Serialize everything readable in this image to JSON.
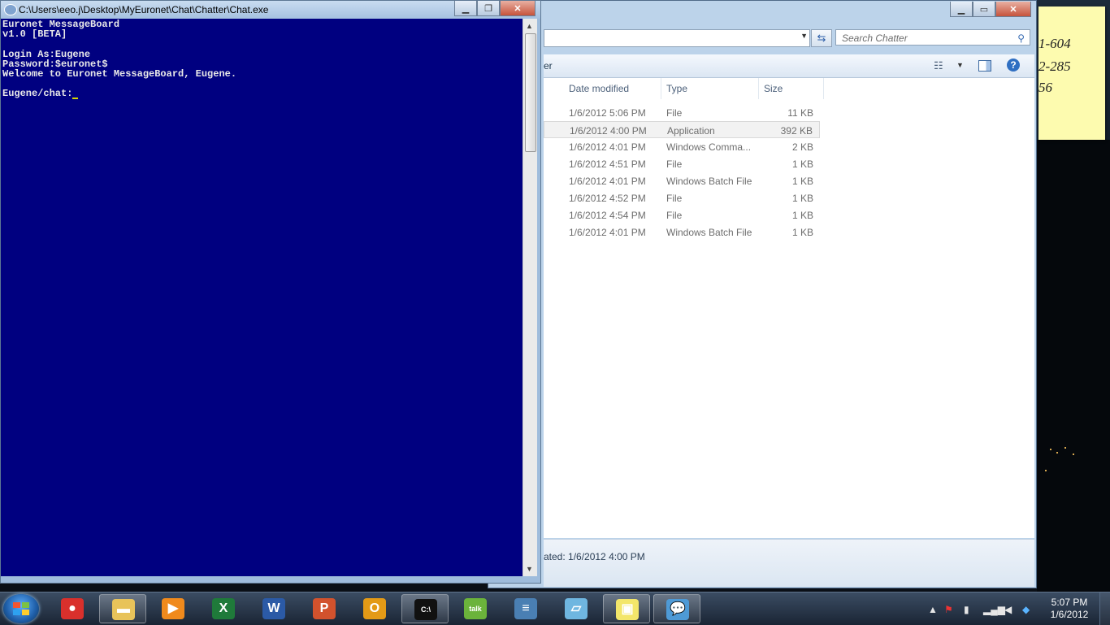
{
  "sticky_note": {
    "lines": [
      "1-604",
      "2-285",
      "56"
    ]
  },
  "explorer": {
    "search_placeholder": "Search Chatter",
    "cmdbar_text": "er",
    "columns": [
      "Date modified",
      "Type",
      "Size"
    ],
    "files": [
      {
        "date": "1/6/2012 5:06 PM",
        "type": "File",
        "size": "11 KB"
      },
      {
        "date": "1/6/2012 4:00 PM",
        "type": "Application",
        "size": "392 KB"
      },
      {
        "date": "1/6/2012 4:01 PM",
        "type": "Windows Comma...",
        "size": "2 KB"
      },
      {
        "date": "1/6/2012 4:51 PM",
        "type": "File",
        "size": "1 KB"
      },
      {
        "date": "1/6/2012 4:01 PM",
        "type": "Windows Batch File",
        "size": "1 KB"
      },
      {
        "date": "1/6/2012 4:52 PM",
        "type": "File",
        "size": "1 KB"
      },
      {
        "date": "1/6/2012 4:54 PM",
        "type": "File",
        "size": "1 KB"
      },
      {
        "date": "1/6/2012 4:01 PM",
        "type": "Windows Batch File",
        "size": "1 KB"
      }
    ],
    "details_text": "ated: 1/6/2012 4:00 PM"
  },
  "console": {
    "title": "C:\\Users\\eeo.j\\Desktop\\MyEuronet\\Chat\\Chatter\\Chat.exe",
    "lines": [
      "Euronet MessageBoard",
      "v1.0 [BETA]",
      "",
      "Login As:Eugene",
      "Password:$euronet$",
      "Welcome to Euronet MessageBoard, Eugene.",
      "",
      "Eugene/chat:"
    ]
  },
  "taskbar": {
    "items": [
      {
        "name": "chrome",
        "icon": "chrome-icon",
        "color": "#d9302c",
        "glyph": "●"
      },
      {
        "name": "windows-explorer",
        "icon": "folder-icon",
        "color": "#e8c35a",
        "glyph": "▬"
      },
      {
        "name": "media-player",
        "icon": "play-icon",
        "color": "#f08a1c",
        "glyph": "▶"
      },
      {
        "name": "excel",
        "icon": "excel-icon",
        "color": "#1f7a3a",
        "glyph": "X"
      },
      {
        "name": "word",
        "icon": "word-icon",
        "color": "#2b5aa6",
        "glyph": "W"
      },
      {
        "name": "powerpoint",
        "icon": "powerpoint-icon",
        "color": "#d2522d",
        "glyph": "P"
      },
      {
        "name": "outlook",
        "icon": "outlook-icon",
        "color": "#e39a16",
        "glyph": "O"
      },
      {
        "name": "command-prompt",
        "icon": "cmd-icon",
        "color": "#111111",
        "glyph": "C:\\"
      },
      {
        "name": "google-talk",
        "icon": "talk-icon",
        "color": "#6bb33b",
        "glyph": "talk"
      },
      {
        "name": "python",
        "icon": "python-icon",
        "color": "#4a7fb3",
        "glyph": "≡"
      },
      {
        "name": "notepad",
        "icon": "notepad-icon",
        "color": "#6fb6e0",
        "glyph": "▱"
      },
      {
        "name": "sticky-notes",
        "icon": "sticky-icon",
        "color": "#f3e66a",
        "glyph": "▣"
      },
      {
        "name": "chat",
        "icon": "chat-bubble-icon",
        "color": "#4e9ad6",
        "glyph": "💬"
      }
    ],
    "time": "5:07 PM",
    "date": "1/6/2012"
  }
}
